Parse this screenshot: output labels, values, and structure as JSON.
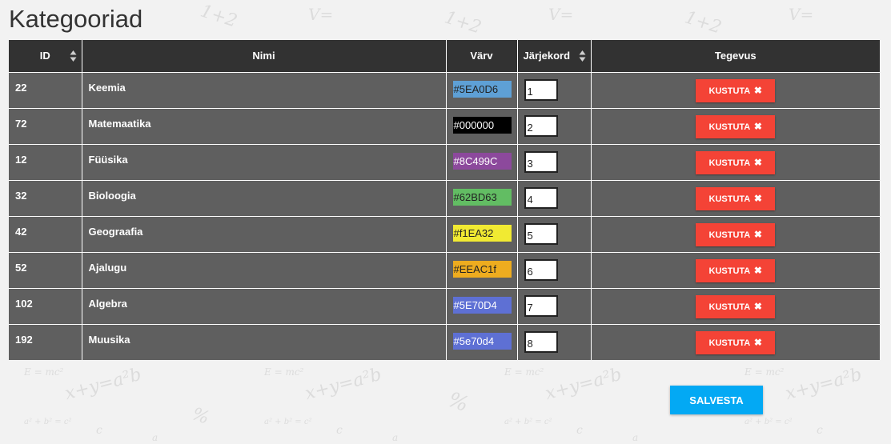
{
  "page": {
    "title": "Kategooriad"
  },
  "table": {
    "headers": {
      "id": "ID",
      "name": "Nimi",
      "color": "Värv",
      "order": "Järjekord",
      "actions": "Tegevus"
    },
    "rows": [
      {
        "id": "22",
        "name": "Keemia",
        "color": "#5EA0D6",
        "order": "1",
        "delete_label": "KUSTUTA"
      },
      {
        "id": "72",
        "name": "Matemaatika",
        "color": "#000000",
        "order": "2",
        "delete_label": "KUSTUTA"
      },
      {
        "id": "12",
        "name": "Füüsika",
        "color": "#8C499C",
        "order": "3",
        "delete_label": "KUSTUTA"
      },
      {
        "id": "32",
        "name": "Bioloogia",
        "color": "#62BD63",
        "order": "4",
        "delete_label": "KUSTUTA"
      },
      {
        "id": "42",
        "name": "Geograafia",
        "color": "#f1EA32",
        "order": "5",
        "delete_label": "KUSTUTA"
      },
      {
        "id": "52",
        "name": "Ajalugu",
        "color": "#EEAC1f",
        "order": "6",
        "delete_label": "KUSTUTA"
      },
      {
        "id": "102",
        "name": "Algebra",
        "color": "#5E70D4",
        "order": "7",
        "delete_label": "KUSTUTA"
      },
      {
        "id": "192",
        "name": "Muusika",
        "color": "#5e70d4",
        "order": "8",
        "delete_label": "KUSTUTA"
      }
    ]
  },
  "save_label": "SALVESTA",
  "colors": {
    "header_bg": "#323232",
    "row_bg": "#5f5f5f",
    "delete": "#f44336",
    "save": "#03a9f4"
  },
  "icons": {
    "sort": "sort-icon",
    "delete": "close-icon"
  }
}
